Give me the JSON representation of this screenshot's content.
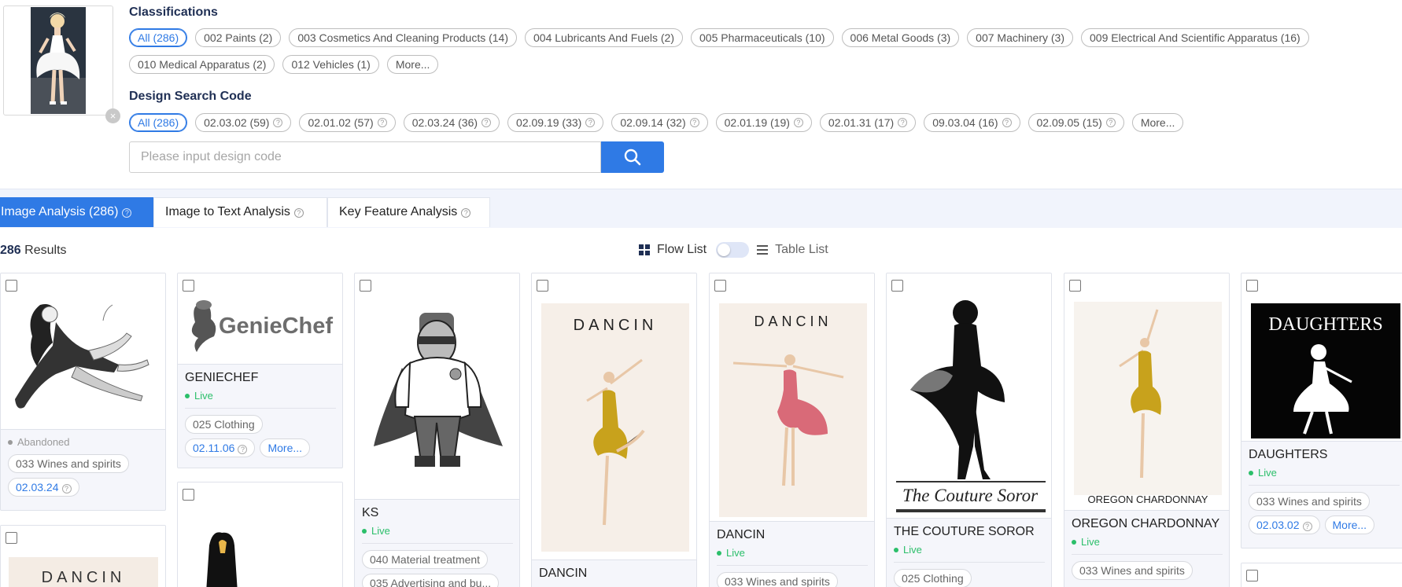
{
  "classifications": {
    "title": "Classifications",
    "chips": [
      "All (286)",
      "002 Paints (2)",
      "003 Cosmetics And Cleaning Products (14)",
      "004 Lubricants And Fuels (2)",
      "005 Pharmaceuticals (10)",
      "006 Metal Goods (3)",
      "007 Machinery (3)",
      "009 Electrical And Scientific Apparatus (16)",
      "010 Medical Apparatus (2)",
      "012 Vehicles (1)",
      "More..."
    ]
  },
  "design_search": {
    "title": "Design Search Code",
    "chips": [
      "All (286)",
      "02.03.02 (59)",
      "02.01.02 (57)",
      "02.03.24 (36)",
      "02.09.19 (33)",
      "02.09.14 (32)",
      "02.01.19 (19)",
      "02.01.31 (17)",
      "09.03.04 (16)",
      "02.09.05 (15)",
      "More..."
    ],
    "placeholder": "Please input design code"
  },
  "tabs": [
    "Image Analysis (286)",
    "Image to Text Analysis",
    "Key Feature Analysis"
  ],
  "results": {
    "count": "286",
    "label": "Results"
  },
  "view": {
    "flow": "Flow List",
    "table": "Table List"
  },
  "cards": [
    {
      "name": "",
      "status": "Abandoned",
      "tags": [
        "033 Wines and spirits"
      ],
      "codes": [
        "02.03.24"
      ]
    },
    {
      "name": "GENIECHEF",
      "logo": "GenieChef",
      "status": "Live",
      "tags": [
        "025 Clothing"
      ],
      "codes": [
        "02.11.06"
      ],
      "more": "More..."
    },
    {
      "name": "KS",
      "status": "Live",
      "tags": [
        "040 Material treatment",
        "035 Advertising and bu..."
      ]
    },
    {
      "name": "DANCIN",
      "logo": "DANCIN"
    },
    {
      "name": "DANCIN",
      "logo": "DANCIN",
      "status": "Live",
      "tags": [
        "033 Wines and spirits"
      ]
    },
    {
      "name": "THE COUTURE SOROR",
      "logo": "The Couture Soror",
      "status": "Live",
      "tags": [
        "025 Clothing"
      ]
    },
    {
      "name": "OREGON CHARDONNAY",
      "logo": "OREGON CHARDONNAY",
      "status": "Live",
      "tags": [
        "033 Wines and spirits"
      ]
    },
    {
      "name": "DAUGHTERS",
      "logo": "DAUGHTERS",
      "status": "Live",
      "tags": [
        "033 Wines and spirits"
      ],
      "codes": [
        "02.03.02"
      ],
      "more": "More..."
    },
    {
      "logo": "DANCIN"
    }
  ],
  "colors": {
    "accent": "#2f7ae5",
    "live": "#2bbf6a",
    "tab_bar": "#f1f4fc"
  }
}
